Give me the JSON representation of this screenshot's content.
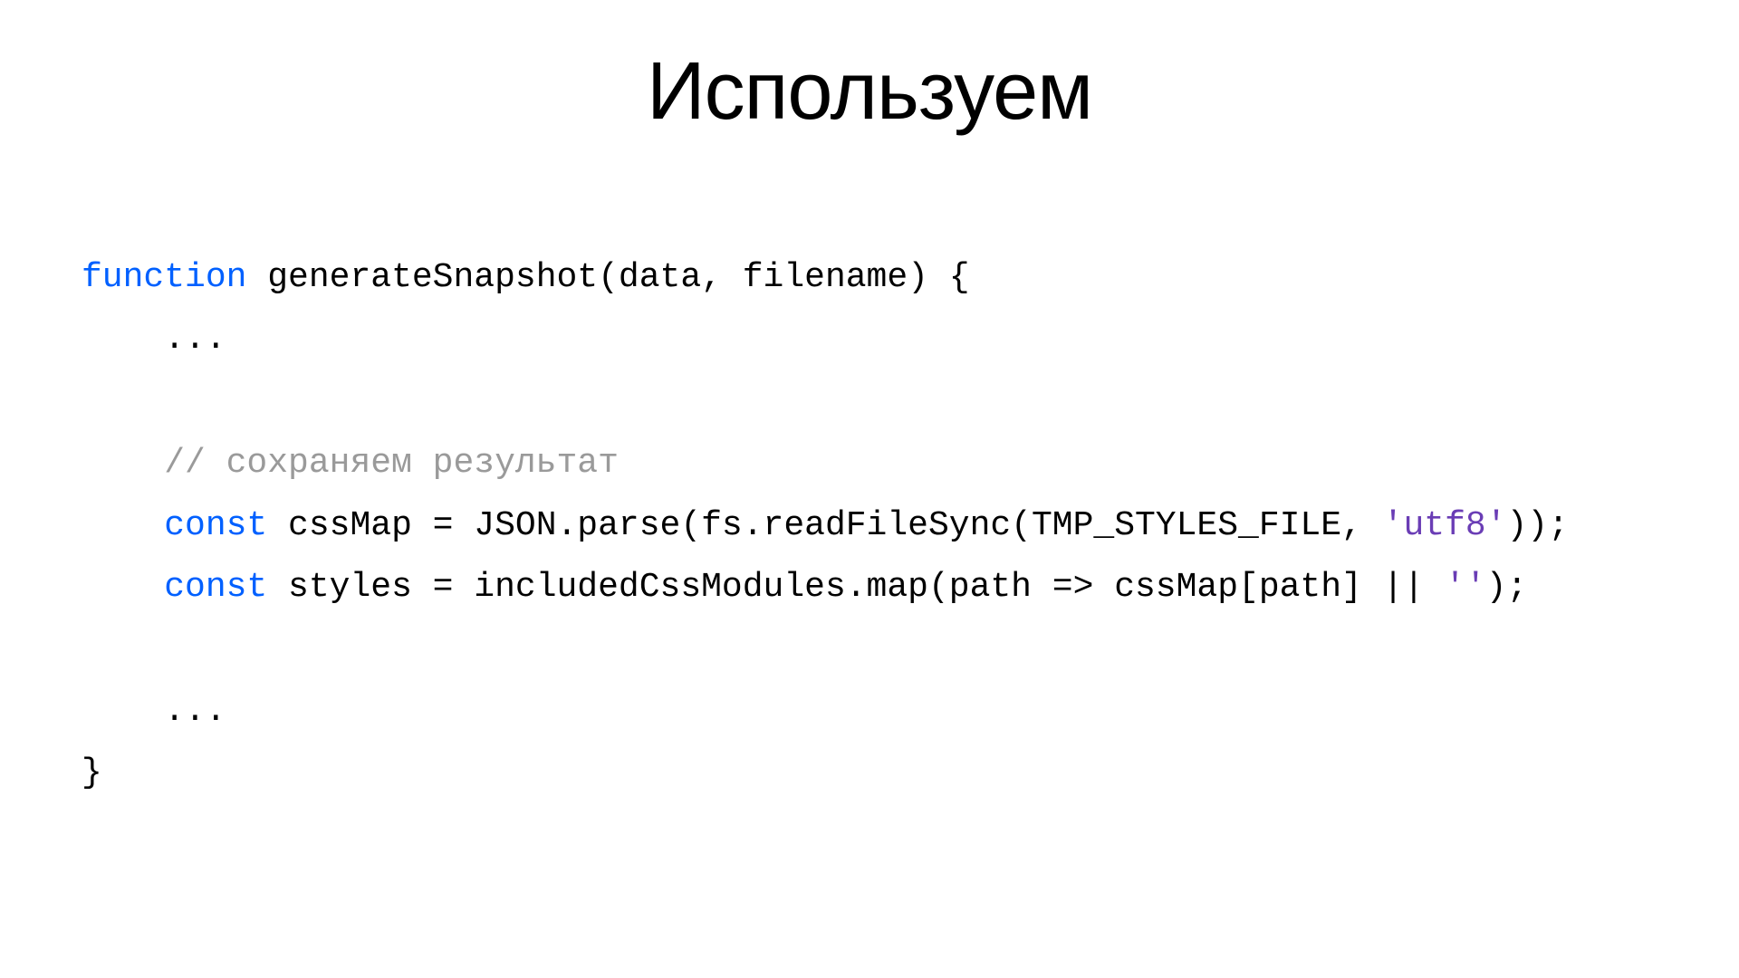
{
  "title": "Используем",
  "code": {
    "line1": {
      "keyword": "function",
      "rest": " generateSnapshot(data, filename) {"
    },
    "line2": "    ...",
    "line3": "",
    "line4": {
      "indent": "    ",
      "comment": "// сохраняем результат"
    },
    "line5": {
      "indent": "    ",
      "keyword": "const",
      "mid": " cssMap = JSON.parse(fs.readFileSync(TMP_STYLES_FILE, ",
      "string": "'utf8'",
      "end": "));"
    },
    "line6": {
      "indent": "    ",
      "keyword": "const",
      "mid": " styles = includedCssModules.map(path => cssMap[path] || ",
      "string": "''",
      "end": ");"
    },
    "line7": "",
    "line8": "    ...",
    "line9": "}"
  }
}
